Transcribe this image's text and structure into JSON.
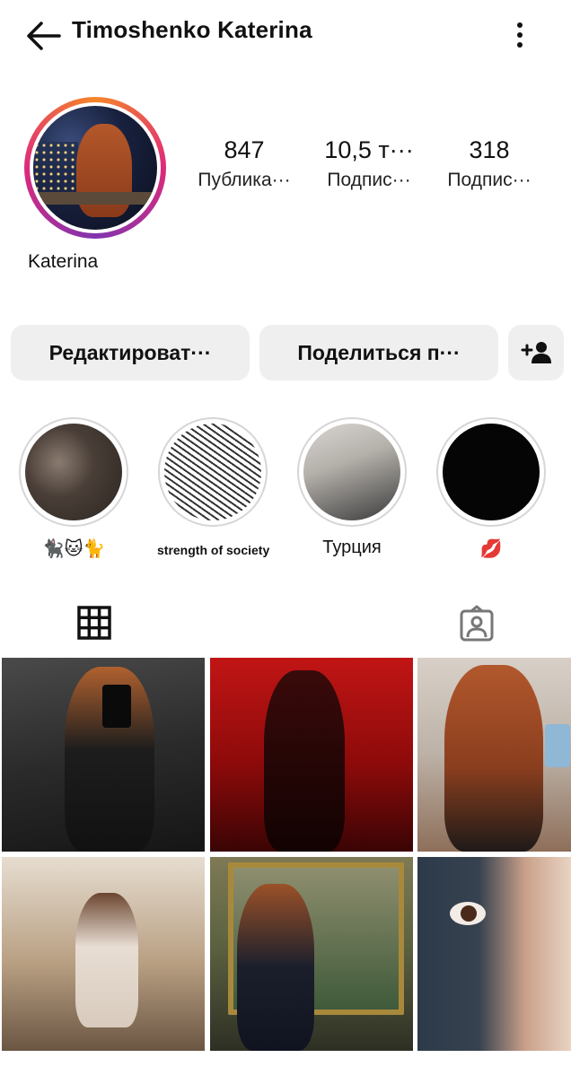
{
  "header": {
    "title": "Timoshenko Katerina",
    "back_icon": "arrow-left-icon",
    "more_icon": "more-vertical-icon"
  },
  "profile": {
    "name": "Katerina",
    "stats": [
      {
        "value": "847",
        "label": "Публика···"
      },
      {
        "value": "10,5 т···",
        "label": "Подпис···"
      },
      {
        "value": "318",
        "label": "Подпис···"
      }
    ]
  },
  "actions": {
    "edit_label": "Редактироват···",
    "share_label": "Поделиться п···",
    "add_person_icon": "add-person-icon"
  },
  "highlights": [
    {
      "caption": "🐈‍⬛🐱🐈"
    },
    {
      "caption": "strength of society"
    },
    {
      "caption": "Турция"
    },
    {
      "caption": "💋"
    }
  ],
  "tabs": {
    "grid_icon": "grid-icon",
    "tagged_icon": "tagged-person-icon"
  },
  "colors": {
    "button_bg": "#efefef",
    "story_ring_gradient": [
      "#f58529",
      "#dd2a7b",
      "#8134af"
    ]
  }
}
